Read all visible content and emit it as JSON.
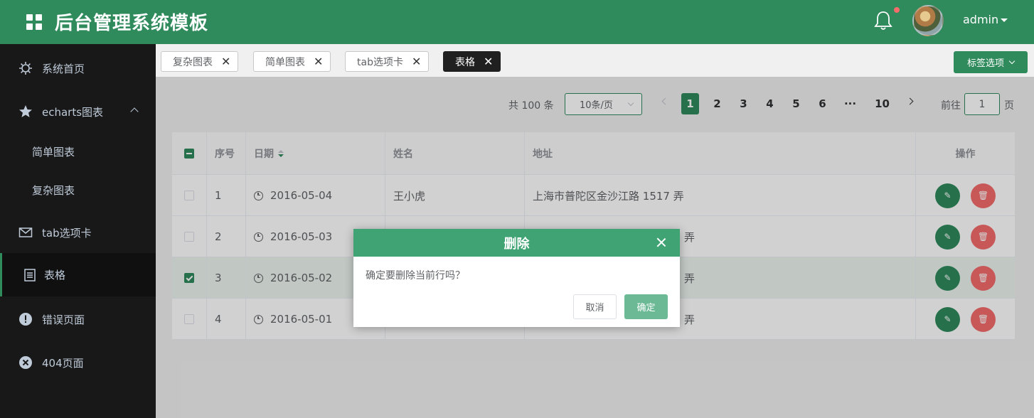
{
  "header": {
    "title": "后台管理系统模板",
    "user": "admin",
    "brand_color": "#2f8a5c",
    "notification_dot": true
  },
  "sidebar": {
    "items": [
      {
        "label": "系统首页",
        "icon": "dashboard-icon"
      },
      {
        "label": "echarts图表",
        "icon": "star-icon",
        "expanded": true
      },
      {
        "label": "简单图表",
        "sub": true
      },
      {
        "label": "复杂图表",
        "sub": true
      },
      {
        "label": "tab选项卡",
        "icon": "mail-icon"
      },
      {
        "label": "表格",
        "icon": "document-icon",
        "active": true
      },
      {
        "label": "错误页面",
        "icon": "warning-icon"
      },
      {
        "label": "404页面",
        "icon": "close-circle-icon"
      }
    ]
  },
  "tabs": {
    "items": [
      {
        "label": "复杂图表"
      },
      {
        "label": "简单图表"
      },
      {
        "label": "tab选项卡"
      },
      {
        "label": "表格",
        "active": true
      }
    ],
    "options_label": "标签选项"
  },
  "pagination": {
    "total_text": "共 100 条",
    "page_size": "10条/页",
    "pages": [
      "1",
      "2",
      "3",
      "4",
      "5",
      "6",
      "···",
      "10"
    ],
    "current_page": "1",
    "goto_label": "前往",
    "goto_value": "1",
    "page_unit": "页"
  },
  "table": {
    "headers": {
      "index": "序号",
      "date": "日期",
      "name": "姓名",
      "address": "地址",
      "ops": "操作"
    },
    "rows": [
      {
        "index": "1",
        "date": "2016-05-04",
        "name": "王小虎",
        "address": "上海市普陀区金沙江路 1517 弄",
        "checked": false
      },
      {
        "index": "2",
        "date": "2016-05-03",
        "name": "",
        "address": "弄",
        "checked": false
      },
      {
        "index": "3",
        "date": "2016-05-02",
        "name": "",
        "address": "弄",
        "checked": true
      },
      {
        "index": "4",
        "date": "2016-05-01",
        "name": "",
        "address": "弄",
        "checked": false
      }
    ]
  },
  "dialog": {
    "title": "删除",
    "message": "确定要删除当前行吗？",
    "cancel_label": "取消",
    "ok_label": "确定"
  }
}
